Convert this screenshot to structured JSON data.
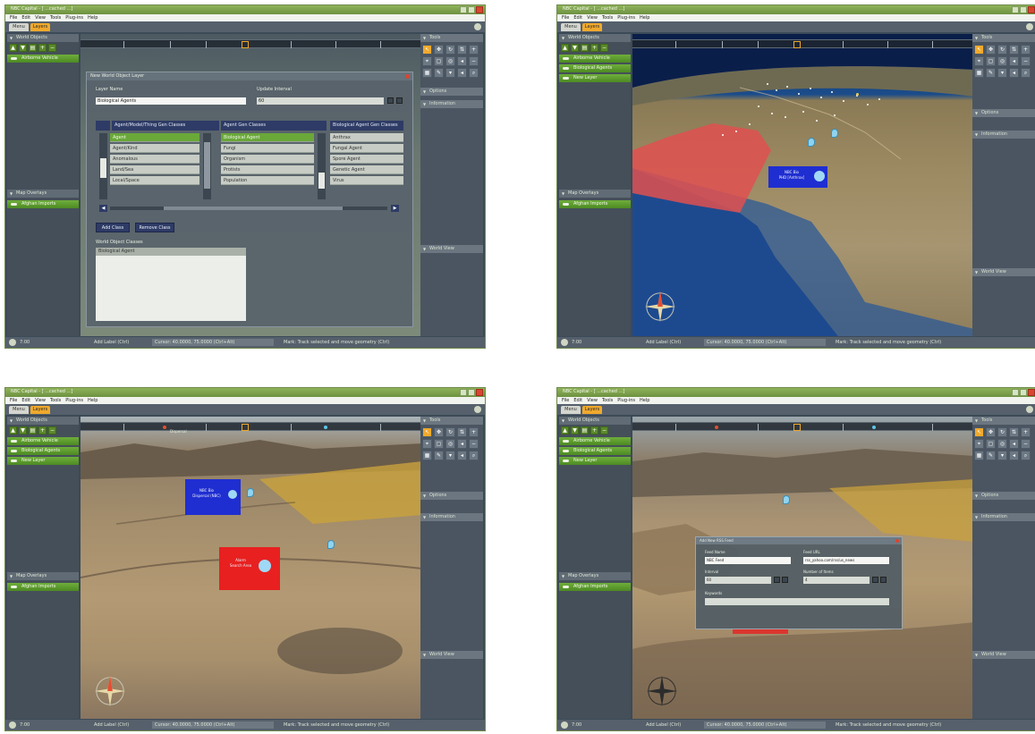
{
  "app": {
    "window_title": "NBC Capital - [ ...cached ...]",
    "menu": [
      "File",
      "Edit",
      "View",
      "Tools",
      "Plug-ins",
      "Help"
    ],
    "tabs": [
      "Menu",
      "Layers"
    ]
  },
  "left_panel": {
    "world_objects_header": "World Objects",
    "map_overlays_header": "Map Overlays",
    "layers": [
      "Airborne Vehicle",
      "Biological Agents",
      "New Layer"
    ],
    "overlays": [
      "Afghan Imports"
    ]
  },
  "right_panel": {
    "tools_header": "Tools",
    "options_header": "Options",
    "information_header": "Information",
    "world_view_header": "World View"
  },
  "status": {
    "time": "7:00",
    "add_label": "Add Label (Ctrl)",
    "coords": "Cursor: 40.0000, 75.0000 (Ctrl+Alt)",
    "hint": "Mark: Track selected and move geometry (Ctrl)"
  },
  "dialog_new_world_object_layer": {
    "title": "New World Object Layer",
    "layer_name_label": "Layer Name",
    "layer_name_value": "Biological Agents",
    "update_interval_label": "Update Interval",
    "update_interval_value": "60",
    "col1_header": "Agent/Model/Thing Gen Classes",
    "col2_header": "Agent Gen Classes",
    "col3_header": "Biological Agent Gen Classes",
    "col1_items": [
      "Agent",
      "Agent/Kind",
      "Anomalous",
      "Land/Sea",
      "Local/Space"
    ],
    "col2_items": [
      "Biological Agent",
      "Fungi",
      "Organism",
      "Protists",
      "Population"
    ],
    "col3_items": [
      "Anthrax",
      "Fungal Agent",
      "Spore Agent",
      "Genetic Agent",
      "Virus"
    ],
    "add_class_button": "Add Class",
    "remove_class_button": "Remove Class",
    "world_object_classes_label": "World Object Classes",
    "world_object_classes_items": [
      "Biological Agent"
    ]
  },
  "map_view_2": {
    "bio_box_line1": "NBC Bio",
    "bio_box_line2": "PHD [Anthrax]"
  },
  "map_view_3": {
    "blue_box_line1": "NBC Bio",
    "blue_box_line2": "Dispersal (NBC)",
    "red_box_line1": "Alarm",
    "red_box_line2": "Search Area",
    "timeline_tag": "Dispersal"
  },
  "dialog_add_feed": {
    "title": "Add New RSS Feed",
    "feed_name_label": "Feed Name",
    "feed_name_value": "NBC Feed",
    "feed_url_label": "Feed URL",
    "feed_url_value": "rss_yahoo.com/rss/us_news",
    "interval_label": "Interval",
    "interval_value": "60",
    "items_label": "Number of Items",
    "items_value": "4",
    "keywords_label": "Keywords",
    "keywords_value": ""
  },
  "colors": {
    "accent_green": "#5b9a2f",
    "tab_orange": "#f0a92c",
    "panel_dark": "#3c4a57",
    "bio_blue": "#1f2ed1",
    "alert_red": "#e82020"
  }
}
